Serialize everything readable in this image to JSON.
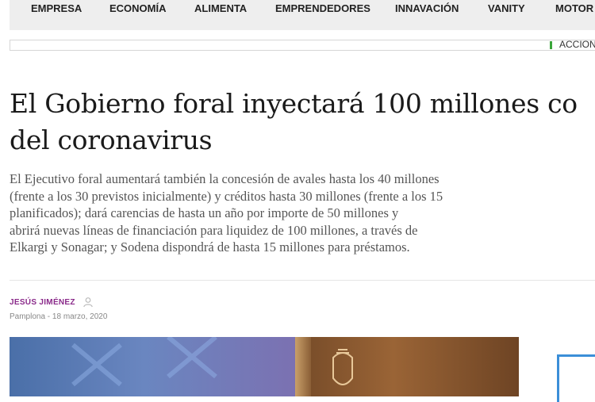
{
  "nav": {
    "items": [
      {
        "label": "EMPRESA"
      },
      {
        "label": "ECONOMÍA"
      },
      {
        "label": "ALIMENTA"
      },
      {
        "label": "EMPRENDEDORES"
      },
      {
        "label": "INNAVACIÓN"
      },
      {
        "label": "VANITY"
      },
      {
        "label": "MOTOR"
      }
    ]
  },
  "ticker": {
    "label": "ACCION"
  },
  "article": {
    "headline_lines": [
      "El Gobierno foral inyectará 100 millones co",
      "del coronavirus"
    ],
    "lede_lines": [
      "El Ejecutivo foral aumentará también la concesión de avales hasta los 40 millones",
      "(frente a los 30 previstos inicialmente) y créditos hasta 30 millones (frente a los 15",
      "planificados); dará carencias de hasta un año por importe de 50 millones y",
      "abrirá nuevas líneas de financiación para liquidez de 100 millones, a través de",
      "Elkargi y Sonagar; y Sodena dispondrá de hasta 15 millones para préstamos."
    ],
    "author": "JESÚS JIMÉNEZ",
    "dateline": "Pamplona - 18 marzo, 2020"
  },
  "colors": {
    "author": "#8a2a8a",
    "ticker_accent": "#3aa53a",
    "side_box": "#3b8fd8"
  },
  "icons": {
    "author": "user-icon"
  }
}
